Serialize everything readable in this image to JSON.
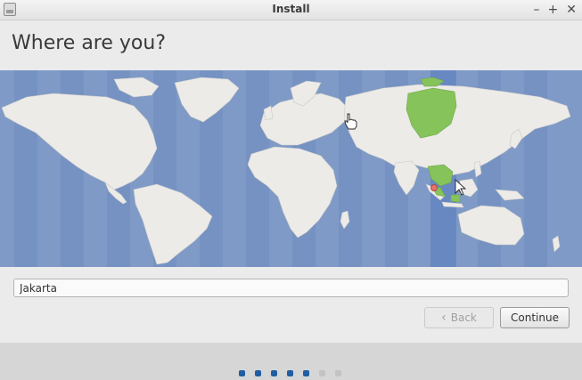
{
  "window": {
    "title": "Install",
    "controls": {
      "minimize": "–",
      "maximize": "+",
      "close": "✕"
    }
  },
  "page": {
    "heading": "Where are you?"
  },
  "location": {
    "value": "Jakarta"
  },
  "buttons": {
    "back_label": "Back",
    "continue_label": "Continue"
  },
  "progress": {
    "total_steps": 7,
    "completed_steps": 5
  },
  "colors": {
    "ocean": "#7f9ac6",
    "land": "#ecebe8",
    "timezone_band": "#6b8bc2",
    "highlight_land": "#86c35a",
    "progress_active": "#1f5fa0",
    "progress_inactive": "#c3c3c3"
  }
}
